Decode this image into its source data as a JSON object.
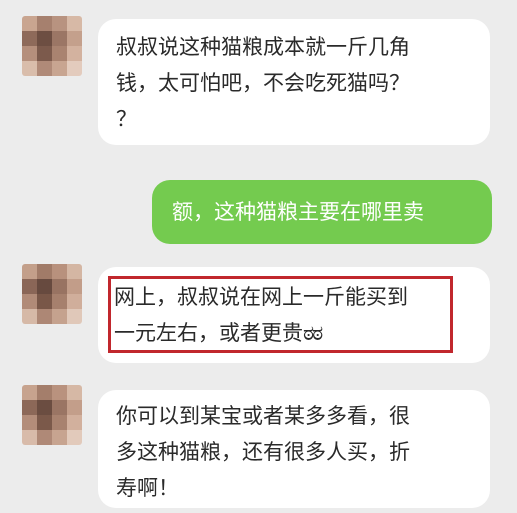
{
  "chat": {
    "messages": [
      {
        "side": "left",
        "lines": [
          "叔叔说这种猫粮成本就一斤几角",
          "钱，太可怕吧，不会吃死猫吗？",
          "？"
        ]
      },
      {
        "side": "right",
        "lines": [
          "额，这种猫粮主要在哪里卖"
        ]
      },
      {
        "side": "left",
        "lines": [
          "网上，叔叔说在网上一斤能买到",
          "一元左右，或者更贵"
        ],
        "emoji": "ಠಠ"
      },
      {
        "side": "left",
        "lines": [
          "你可以到某宝或者某多多看，很",
          "多这种猫粮，还有很多人买，折",
          "寿啊！"
        ]
      }
    ]
  },
  "colors": {
    "background": "#ececec",
    "outgoing_bubble": "#74cb4f",
    "incoming_bubble": "#ffffff",
    "highlight_border": "#c1272d"
  }
}
